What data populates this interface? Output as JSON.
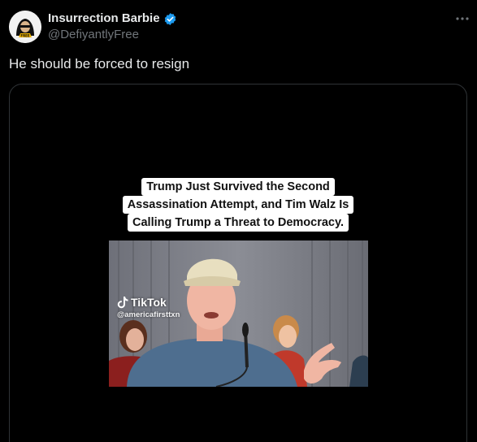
{
  "author": {
    "display_name": "Insurrection Barbie",
    "handle": "@DefiyantlyFree",
    "verified": true,
    "verified_color": "#1d9bf0"
  },
  "tweet": {
    "text": "He should be forced to resign"
  },
  "media": {
    "caption_lines": [
      "Trump Just Survived the Second",
      "Assassination Attempt, and Tim Walz Is",
      "Calling Trump a Threat to Democracy."
    ],
    "watermark_brand": "TikTok",
    "watermark_handle": "@americafirsttxn"
  },
  "icons": {
    "more": "more-horizontal-icon",
    "verified": "verified-badge-icon",
    "tiktok": "tiktok-logo-icon"
  }
}
